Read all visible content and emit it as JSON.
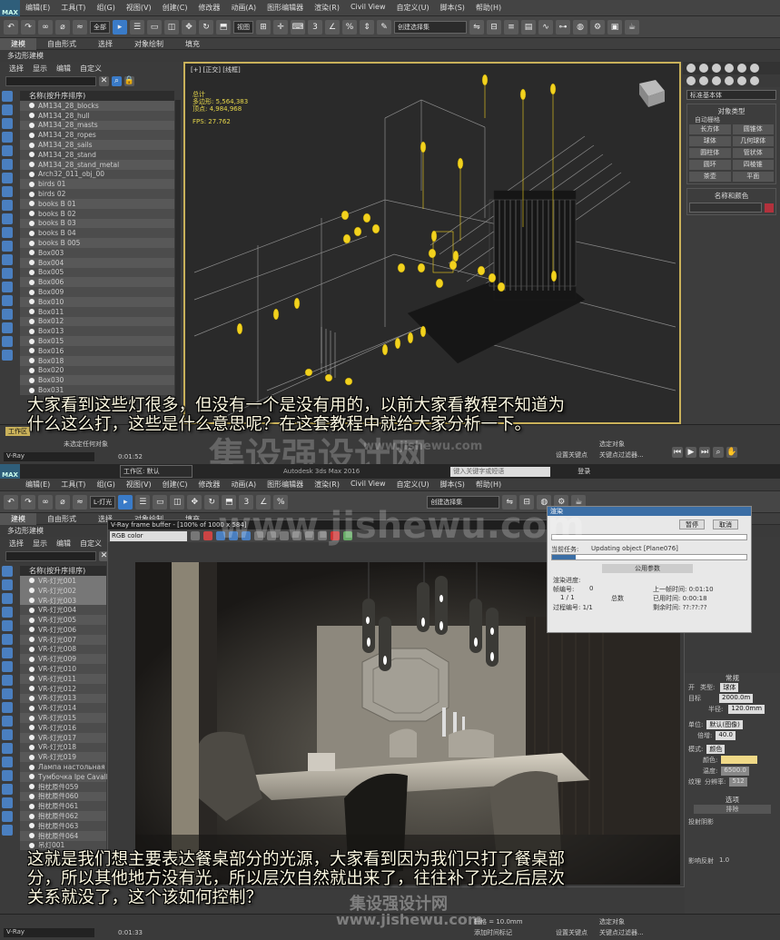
{
  "panel1": {
    "menu": [
      "编辑(E)",
      "工具(T)",
      "组(G)",
      "视图(V)",
      "创建(C)",
      "修改器",
      "动画(A)",
      "图形编辑器",
      "渲染(R)",
      "Civil View",
      "自定义(U)",
      "脚本(S)",
      "帮助(H)"
    ],
    "toolbar_select": "全部",
    "view_select": "视图",
    "snap": "2.5",
    "selection_set": "创建选择集",
    "ribbon_tabs": [
      "建模",
      "自由形式",
      "选择",
      "对象绘制",
      "填充"
    ],
    "ribbon_sub": "多边形建模",
    "scene_menu": [
      "选择",
      "显示",
      "编辑",
      "自定义"
    ],
    "list_header": "名称(按升序排序)",
    "objects": [
      "AM134_28_blocks",
      "AM134_28_hull",
      "AM134_28_masts",
      "AM134_28_ropes",
      "AM134_28_sails",
      "AM134_28_stand",
      "AM134_28_stand_metal",
      "Arch32_011_obj_00",
      "birds 01",
      "birds 02",
      "books B 01",
      "books B 02",
      "books B 03",
      "books B 04",
      "books B 005",
      "Box003",
      "Box004",
      "Box005",
      "Box006",
      "Box009",
      "Box010",
      "Box011",
      "Box012",
      "Box013",
      "Box015",
      "Box016",
      "Box018",
      "Box020",
      "Box030",
      "Box031"
    ],
    "viewport_label": "[+] [正交] [线框]",
    "stats": {
      "total": "总计",
      "poly_label": "多边形:",
      "poly": "5,564,383",
      "vert_label": "顶点:",
      "vert": "4,984,968",
      "fps_label": "FPS:",
      "fps": "27.762"
    },
    "cmd": {
      "category": "标准基本体",
      "object_type": "对象类型",
      "auto_grid": "自动栅格",
      "buttons": [
        "长方体",
        "圆锥体",
        "球体",
        "几何球体",
        "圆柱体",
        "管状体",
        "圆环",
        "四棱锥",
        "茶壶",
        "平面"
      ],
      "name_color": "名称和颜色"
    },
    "status": {
      "work": "工作区",
      "maxscript": "未选定任何对象",
      "time": "0:01:52",
      "set_key": "设置关键点",
      "key_filter": "关键点过滤器...",
      "selected": "选定对象"
    },
    "subtitle": "大家看到这些灯很多，但没有一个是没有用的，以前大家看教程不知道为\n什么这么打，这些是什么意思呢？在这套教程中就给大家分析一下。"
  },
  "panel2": {
    "title_bar": "Autodesk 3ds Max 2016",
    "workspace": "工作区: 默认",
    "search": "键入关键字或短语",
    "login": "登录",
    "menu": [
      "编辑(E)",
      "工具(T)",
      "组(G)",
      "视图(V)",
      "创建(C)",
      "修改器",
      "动画(A)",
      "图形编辑器",
      "渲染(R)",
      "Civil View",
      "自定义(U)",
      "脚本(S)",
      "帮助(H)"
    ],
    "filter": "L-灯光",
    "ribbon_tabs": [
      "建模",
      "自由形式",
      "选择",
      "对象绘制",
      "填充"
    ],
    "ribbon_sub": "多边形建模",
    "scene_menu": [
      "选择",
      "显示",
      "编辑",
      "自定义"
    ],
    "list_header": "名称(按升序排序)",
    "objects": [
      "VR-灯光001",
      "VR-灯光002",
      "VR-灯光003",
      "VR-灯光004",
      "VR-灯光005",
      "VR-灯光006",
      "VR-灯光007",
      "VR-灯光008",
      "VR-灯光009",
      "VR-灯光010",
      "VR-灯光011",
      "VR-灯光012",
      "VR-灯光013",
      "VR-灯光014",
      "VR-灯光015",
      "VR-灯光016",
      "VR-灯光017",
      "VR-灯光018",
      "VR-灯光019",
      "Лампа настольная",
      "Тумбочка Ipe Cavalli",
      "抱枕原件059",
      "抱枕原件060",
      "抱枕原件061",
      "抱枕原件062",
      "抱枕原件063",
      "抱枕原件064",
      "吊灯001"
    ],
    "vfb": {
      "title": "V-Ray frame buffer - [100% of 1000 x 584]",
      "channel": "RGB color"
    },
    "progress": {
      "title": "渲染",
      "pause": "暂停",
      "cancel": "取消",
      "current_task_label": "当前任务:",
      "current_task": "Updating object [Plane076]",
      "common": "公用参数",
      "render_progress": "渲染进度:",
      "frame_label": "帧编号:",
      "frame": "0",
      "total_label": "总数",
      "frame_count": "1 / 1",
      "last_frame": "上一帧时间: 0:01:10",
      "elapsed": "已用时间: 0:00:18",
      "remaining": "剩余时间: ??:??:??",
      "pass": "过程编号: 1/1"
    },
    "cmd": {
      "section": "常规",
      "on": "开",
      "type_label": "类型:",
      "type": "球体",
      "target": "目标",
      "length": "2000.0m",
      "radius_label": "半径:",
      "radius": "120.0mm",
      "unit_label": "单位:",
      "unit": "默认(图像)",
      "multiplier_label": "倍增:",
      "multiplier": "40.0",
      "mode_label": "模式:",
      "mode": "颜色",
      "color_label": "颜色:",
      "temp_label": "温度:",
      "temp": "6500.0",
      "texture": "纹理",
      "resolution": "分辨率:",
      "res_value": "512",
      "options": "选项",
      "exclude": "排除",
      "cast_shadows": "投射阴影",
      "affect_reflect": "影响反射",
      "unit_100": "1.0"
    },
    "status": {
      "grid": "栅格 = 10.0mm",
      "add_tag": "添加时间标记",
      "time": "0:01:33",
      "set_key": "设置关键点",
      "key_filter": "关键点过滤器...",
      "selected": "选定对象"
    },
    "subtitle": "这就是我们想主要表达餐桌部分的光源，大家看到因为我们只打了餐桌部\n分，所以其他地方没有光，所以层次自然就出来了，往往补了光之后层次\n关系就没了，这个该如何控制？"
  },
  "watermarks": {
    "site": "集设强设计网",
    "url": "www.jishewu.com",
    "url2": "www.jishewu.com"
  }
}
